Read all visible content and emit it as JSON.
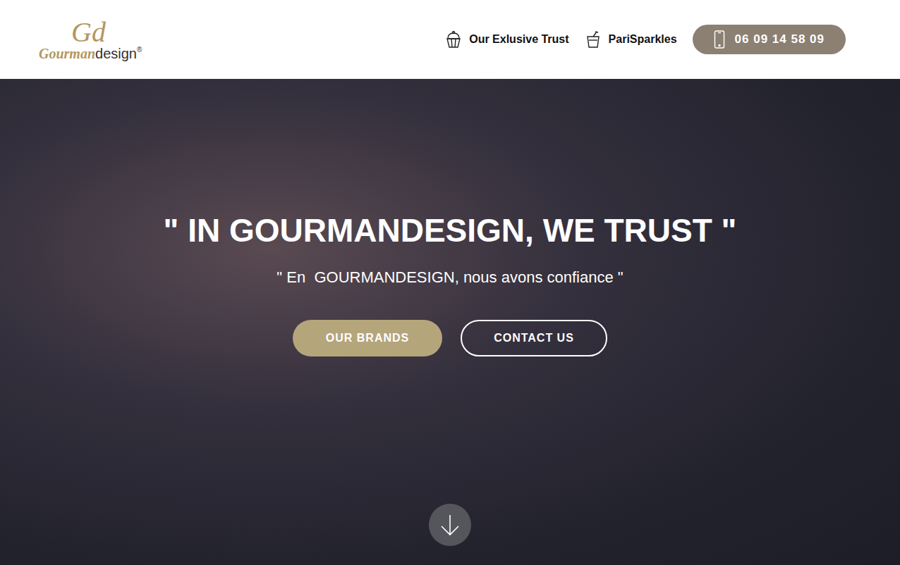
{
  "header": {
    "logo": {
      "monogram": "Gd",
      "name_part1": "Gourman",
      "name_part2": "design",
      "mark": "®"
    },
    "nav": [
      {
        "label": "Our Exlusive Trust"
      },
      {
        "label": "PariSparkles"
      }
    ],
    "phone": "06 09 14 58 09"
  },
  "hero": {
    "title": "\" IN GOURMANDESIGN, WE TRUST \"",
    "subtitle": "\" En  GOURMANDESIGN, nous avons confiance \"",
    "buttons": [
      {
        "label": "OUR BRANDS",
        "kind": "filled"
      },
      {
        "label": "CONTACT US",
        "kind": "outline"
      }
    ]
  }
}
